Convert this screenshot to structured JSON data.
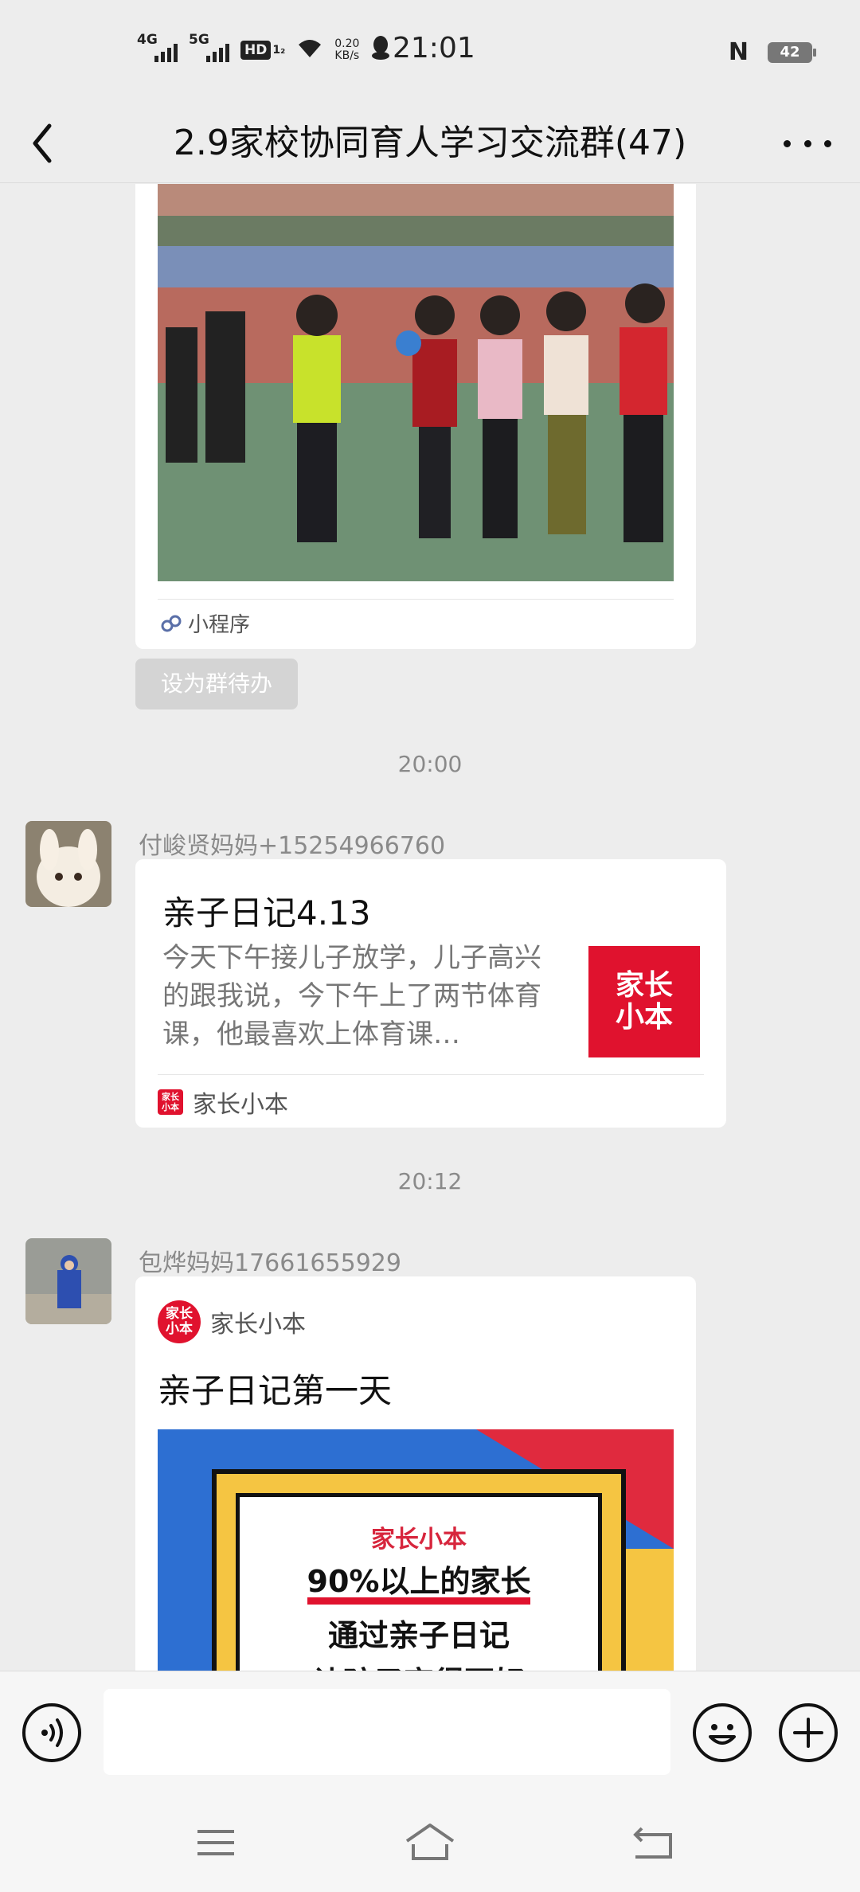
{
  "status_bar": {
    "signal_1": "4G",
    "signal_2": "5G",
    "hd_label": "HD",
    "hd_sub": "1₂",
    "net_speed_value": "0.20",
    "net_speed_unit": "KB/s",
    "time": "21:01",
    "nfc_label": "N",
    "battery": "42"
  },
  "header": {
    "title": "2.9家校协同育人学习交流群(47)",
    "back_icon": "chevron-left-icon",
    "more_icon": "more-dots-icon"
  },
  "messages": {
    "m1": {
      "miniprogram_label": "小程序",
      "todo_button": "设为群待办"
    },
    "time_1": "20:00",
    "m2": {
      "sender": "付峻贤妈妈+15254966760",
      "card_title": "亲子日记4.13",
      "card_desc": "今天下午接儿子放学，儿子高兴的跟我说，今下午上了两节体育课，他最喜欢上体育课…",
      "thumb_line1": "家长",
      "thumb_line2": "小本",
      "source": "家长小本"
    },
    "time_2": "20:12",
    "m3": {
      "sender": "包烨妈妈17661655929",
      "source": "家长小本",
      "card_title": "亲子日记第一天",
      "promo_logo": "家长小本",
      "promo_line1": "90%以上的家长",
      "promo_line2": "通过亲子日记",
      "promo_line3": "让孩子变得更好"
    }
  },
  "logo_text": {
    "line1": "家长",
    "line2": "小本"
  },
  "input_bar": {
    "voice_icon": "voice-icon",
    "emoji_icon": "emoji-icon",
    "plus_icon": "plus-icon",
    "placeholder": ""
  },
  "nav_bar": {
    "menu_icon": "menu-icon",
    "home_icon": "home-icon",
    "back_icon": "back-icon"
  },
  "colors": {
    "background": "#ededed",
    "brand_red": "#e0122e",
    "card": "#ffffff",
    "muted_text": "#8a8a8a"
  }
}
